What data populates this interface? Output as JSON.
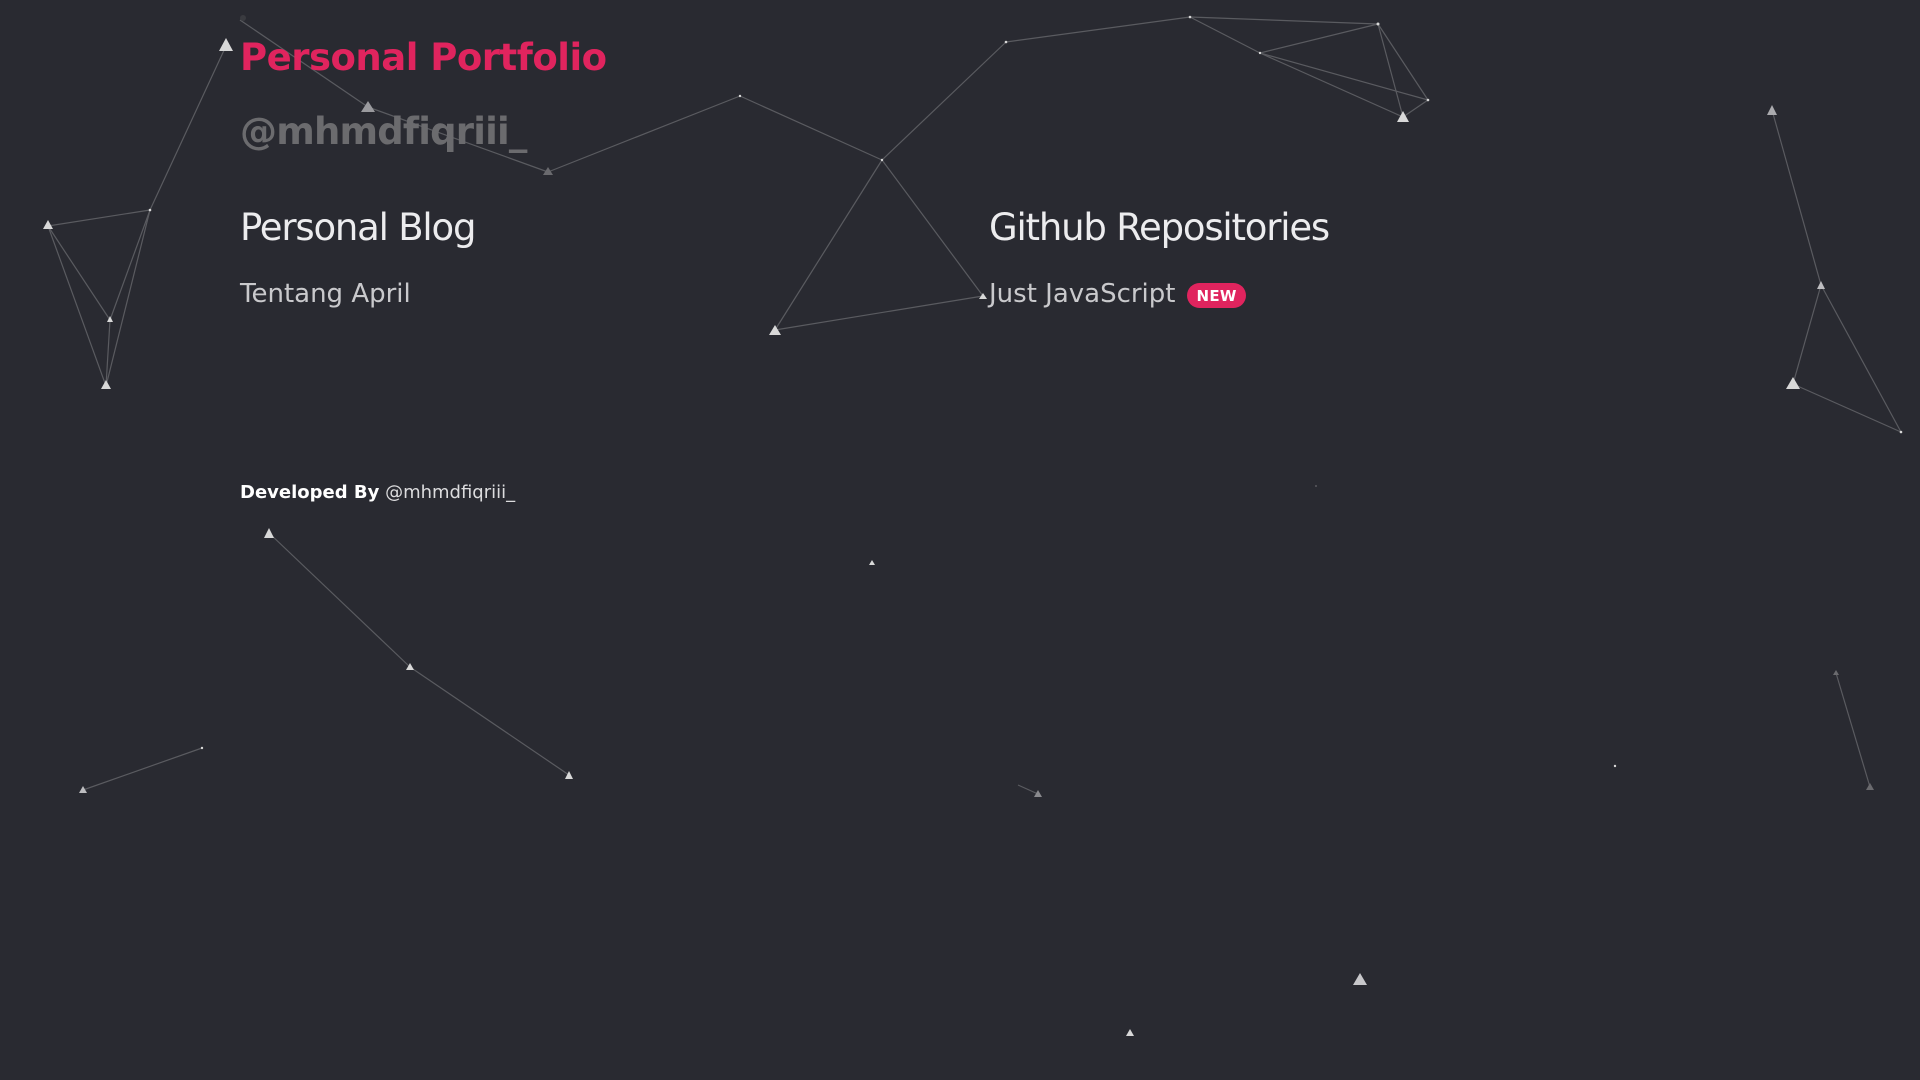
{
  "header": {
    "title": "Personal Portfolio",
    "handle": "@mhmdfiqriii_"
  },
  "sections": {
    "blog": {
      "heading": "Personal Blog",
      "items": [
        {
          "label": "Tentang April"
        }
      ]
    },
    "repos": {
      "heading": "Github Repositories",
      "items": [
        {
          "label": "Just JavaScript",
          "badge": "NEW"
        }
      ]
    }
  },
  "footer": {
    "label": "Developed By",
    "link": "@mhmdfiqriii_"
  },
  "colors": {
    "background": "#292a31",
    "accent": "#e0245e",
    "particle": "#d8d8d8",
    "link_line": "#5a5b60"
  }
}
